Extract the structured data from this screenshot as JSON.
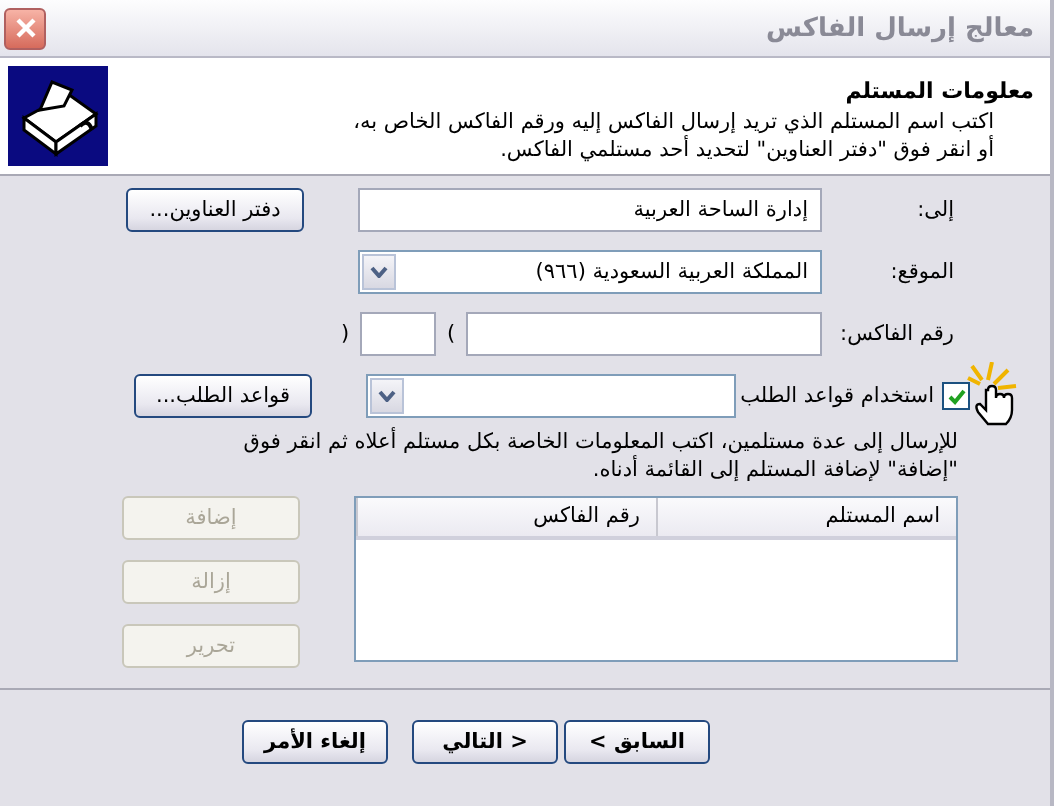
{
  "window": {
    "title": "معالج إرسال الفاكس"
  },
  "header": {
    "title": "معلومات المستلم",
    "description_lines": [
      "اكتب اسم المستلم الذي تريد إرسال الفاكس إليه ورقم الفاكس الخاص به،",
      "أو انقر فوق \"دفتر العناوين\" لتحديد أحد مستلمي الفاكس."
    ]
  },
  "to": {
    "label": "إلى:",
    "value": "إدارة الساحة العربية",
    "button": "دفتر العناوين..."
  },
  "location": {
    "label": "الموقع:",
    "value": "المملكة العربية السعودية (٩٦٦)"
  },
  "fax_number": {
    "label": "رقم الفاكس:",
    "parens": [
      "(",
      ")"
    ]
  },
  "dialing_rules": {
    "label": "استخدام قواعد الطلب",
    "checked": true,
    "button": "قواعد الطلب..."
  },
  "instructions": [
    "للإرسال إلى عدة مستلمين، اكتب المعلومات الخاصة بكل مستلم أعلاه ثم انقر فوق",
    "\"إضافة\" لإضافة المستلم إلى القائمة أدناه."
  ],
  "recipients_table": {
    "columns": [
      "اسم المستلم",
      "رقم الفاكس"
    ]
  },
  "list_buttons": [
    {
      "label": "إضافة",
      "disabled": true
    },
    {
      "label": "إزالة",
      "disabled": true
    },
    {
      "label": "تحرير",
      "disabled": true
    }
  ],
  "footer_buttons": [
    {
      "label": "< السابق",
      "disabled": false
    },
    {
      "label": "التالي >",
      "disabled": false
    },
    {
      "label": "إلغاء الأمر",
      "disabled": false
    }
  ]
}
